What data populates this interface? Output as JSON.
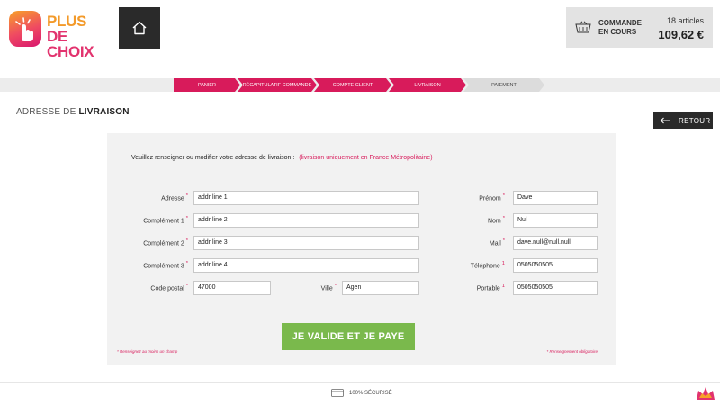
{
  "brand": {
    "line1": "PLUS",
    "line2": "DE CHOIX"
  },
  "cart": {
    "label_line1": "COMMANDE",
    "label_line2": "EN COURS",
    "count": "18 articles",
    "total": "109,62 €"
  },
  "steps": [
    {
      "label": "PANIER",
      "state": "done"
    },
    {
      "label": "RÉCAPITULATIF COMMANDE",
      "state": "done"
    },
    {
      "label": "COMPTE CLIENT",
      "state": "done"
    },
    {
      "label": "LIVRAISON",
      "state": "done"
    },
    {
      "label": "PAIEMENT",
      "state": "todo"
    }
  ],
  "page": {
    "title_light": "ADRESSE DE",
    "title_bold": "LIVRAISON",
    "back_label": "RETOUR"
  },
  "form": {
    "intro": "Veuillez renseigner ou modifier votre adresse de livraison :",
    "intro_note": "(livraison uniquement en France Métropolitaine)",
    "fields": {
      "adresse": {
        "label": "Adresse",
        "mark": "*",
        "value": "addr line 1"
      },
      "complement1": {
        "label": "Complément 1",
        "mark": "*",
        "value": "addr line 2"
      },
      "complement2": {
        "label": "Complément 2",
        "mark": "*",
        "value": "addr line 3"
      },
      "complement3": {
        "label": "Complément 3",
        "mark": "*",
        "value": "addr line 4"
      },
      "code_postal": {
        "label": "Code postal",
        "mark": "*",
        "value": "47000"
      },
      "ville": {
        "label": "Ville",
        "mark": "*",
        "value": "Agen"
      },
      "prenom": {
        "label": "Prénom",
        "mark": "*",
        "value": "Dave"
      },
      "nom": {
        "label": "Nom",
        "mark": "*",
        "value": "Nul"
      },
      "mail": {
        "label": "Mail",
        "mark": "*",
        "value": "dave.null@null.null"
      },
      "telephone": {
        "label": "Téléphone",
        "mark": "1",
        "value": "0505050505"
      },
      "portable": {
        "label": "Portable",
        "mark": "1",
        "value": "0505050505"
      }
    },
    "submit_label": "JE VALIDE ET JE PAYE",
    "note_left": "* Renseignez au moins un champ",
    "note_right": "* Renseignement obligatoire"
  },
  "footer": {
    "secure": "100% SÉCURISÉ"
  },
  "colors": {
    "accent": "#d81b5b",
    "submit": "#7ab94c",
    "dark": "#2a2a2a"
  },
  "icons": [
    "hand-pointer-icon",
    "home-icon",
    "basket-icon",
    "arrow-left-icon",
    "card-icon"
  ]
}
